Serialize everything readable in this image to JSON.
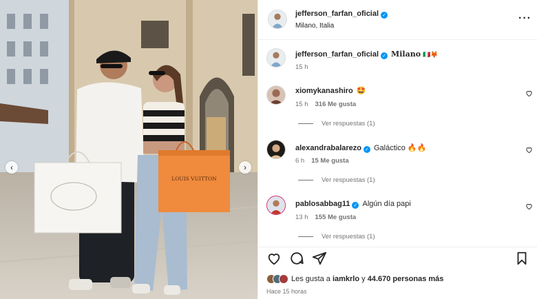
{
  "header": {
    "username": "jefferson_farfan_oficial",
    "location": "Milano, Italia",
    "more_icon": "more-horizontal-icon"
  },
  "caption": {
    "username": "jefferson_farfan_oficial",
    "text": "Milano",
    "emoji": "🇮🇹🦊",
    "time": "15 h"
  },
  "comments": [
    {
      "username": "xiomykanashiro",
      "text": "🤩",
      "time": "15 h",
      "likes": "316 Me gusta",
      "replies": "Ver respuestas (1)"
    },
    {
      "username": "alexandrabalarezo",
      "text": "Galáctico 🔥🔥",
      "time": "6 h",
      "likes": "15 Me gusta",
      "replies": "Ver respuestas (1)"
    },
    {
      "username": "pablosabbag11",
      "text": "Algún día papi",
      "time": "13 h",
      "likes": "155 Me gusta",
      "replies": "Ver respuestas (1)"
    }
  ],
  "footer": {
    "liked_prefix": "Les gusta a",
    "liked_user": "iamkrlo",
    "liked_joiner": "y",
    "liked_count": "44.670 personas más",
    "posted_ago": "Hace 15 horas"
  },
  "photo": {
    "bag_brand": "LOUIS VUITTON",
    "prev_icon": "chevron-left-icon",
    "next_icon": "chevron-right-icon"
  },
  "colors": {
    "verified": "#0095f6",
    "text": "#262626",
    "muted": "#737373",
    "lv_bag": "#f08a3c"
  }
}
